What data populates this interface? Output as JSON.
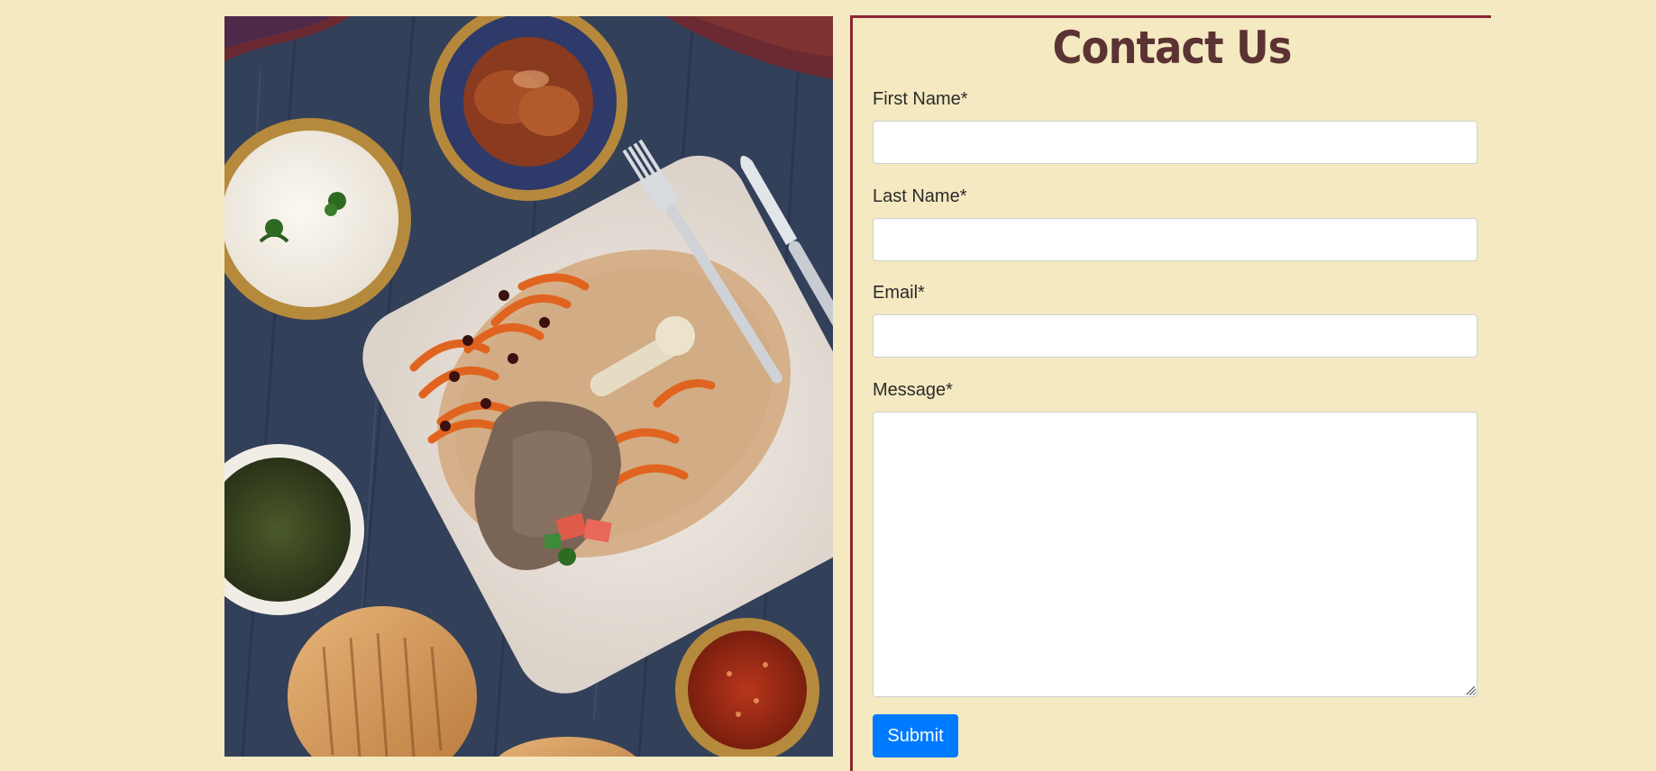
{
  "hero_image": {
    "icon": "afghan-food-platter-image",
    "colors": {
      "table": "#33405a",
      "plate": "#ece6df",
      "rice": "#d9b48a",
      "carrot": "#e0641f",
      "lamb": "#7a6456",
      "yogurt": "#f3efe8",
      "bread": "#d7a060"
    }
  },
  "contact": {
    "title": "Contact Us",
    "fields": {
      "first_name": {
        "label": "First Name*",
        "value": "",
        "placeholder": ""
      },
      "last_name": {
        "label": "Last Name*",
        "value": "",
        "placeholder": ""
      },
      "email": {
        "label": "Email*",
        "value": "",
        "placeholder": ""
      },
      "message": {
        "label": "Message*",
        "value": "",
        "placeholder": ""
      }
    },
    "submit_label": "Submit"
  },
  "colors": {
    "page_background": "#f4e9c0",
    "panel_border": "#8b2434",
    "title": "#5c3333",
    "submit_button": "#007bff"
  }
}
